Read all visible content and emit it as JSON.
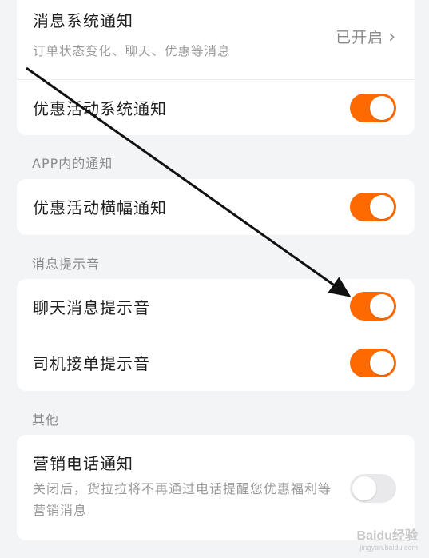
{
  "system_notifications": {
    "message_system": {
      "title": "消息系统通知",
      "subtitle": "订单状态变化、聊天、优惠等消息",
      "status": "已开启"
    },
    "promo_system": {
      "title": "优惠活动系统通知",
      "enabled": true
    }
  },
  "in_app": {
    "section_title": "APP内的通知",
    "promo_banner": {
      "title": "优惠活动横幅通知",
      "enabled": true
    }
  },
  "sounds": {
    "section_title": "消息提示音",
    "chat_sound": {
      "title": "聊天消息提示音",
      "enabled": true
    },
    "driver_sound": {
      "title": "司机接单提示音",
      "enabled": true
    }
  },
  "other": {
    "section_title": "其他",
    "marketing_call": {
      "title": "营销电话通知",
      "subtitle": "关闭后，货拉拉将不再通过电话提醒您优惠福利等营销消息",
      "enabled": false
    }
  },
  "watermark": {
    "text": "Baidu经验",
    "sub": "jingyan.baidu.com"
  },
  "colors": {
    "accent": "#ff6a00",
    "toggle_off": "#e9e9eb",
    "background": "#f3f4f6"
  }
}
